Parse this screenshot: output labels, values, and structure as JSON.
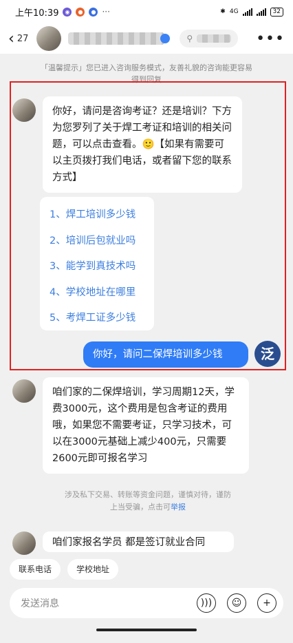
{
  "status_bar": {
    "time": "上午10:39",
    "battery": "32",
    "network": "4G"
  },
  "header": {
    "back_count": "27",
    "more_icon": "more-horizontal-icon"
  },
  "notice": "「温馨提示」您已进入咨询服务模式，友善礼貌的咨询能更容易得到回复",
  "messages": {
    "greeting": "你好，请问是咨询考证？还是培训？下方为您罗列了关于焊工考证和培训的相关问题，可以点击查看。🙂【如果有需要可以主页拨打我们电话，或者留下您的联系方式】",
    "questions": [
      "1、焊工培训多少钱",
      "2、培训后包就业吗",
      "3、能学到真技术吗",
      "4、学校地址在哪里",
      "5、考焊工证多少钱"
    ],
    "user_question": "你好，请问二保焊培训多少钱",
    "reply": "咱们家的二保焊培训，学习周期12天，学费3000元，这个费用是包含考证的费用哦，如果您不需要考证，只学习技术，可以在3000元基础上减少400元，只需要2600元即可报名学习",
    "partial": "咱们家报名学员 都是签订就业合同"
  },
  "warning": {
    "text": "涉及私下交易、转账等资金问题，谨慎对待，谨防上当受骗，点击可",
    "link": "举报"
  },
  "quick_replies": [
    "联系电话",
    "学校地址"
  ],
  "input": {
    "placeholder": "发送消息"
  },
  "colors": {
    "user_bubble": "#2f7cf6",
    "link": "#3d7fe0",
    "highlight": "#e02020"
  }
}
